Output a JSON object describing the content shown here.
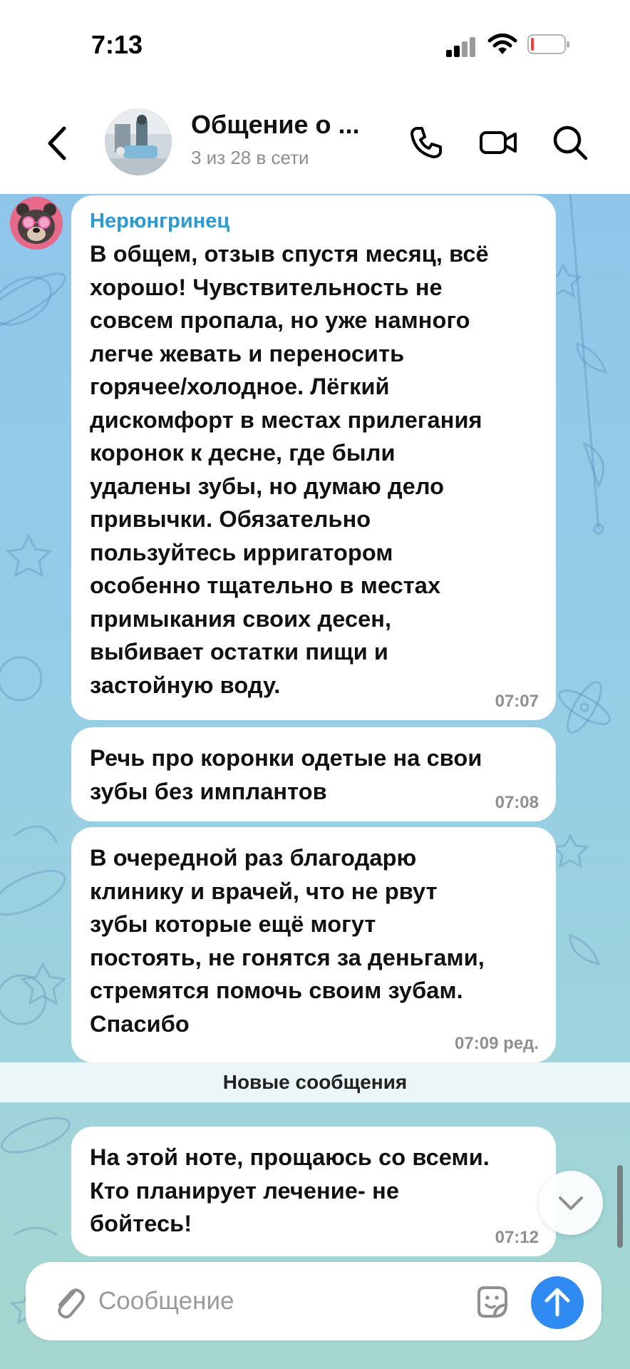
{
  "status_bar": {
    "time": "7:13",
    "battery_level": 0.08
  },
  "header": {
    "title": "Общение о ...",
    "subtitle": "3 из 28 в сети",
    "icons": [
      "chevron-left-icon",
      "phone-icon",
      "video-camera-icon",
      "search-icon"
    ]
  },
  "messages": [
    {
      "sender": "Нерюнгринец",
      "lines": [
        "В общем, отзыв спустя месяц, всё",
        "хорошо! Чувствительность не",
        "совсем пропала, но уже намного",
        "легче жевать и переносить",
        "горячее/холодное. Лёгкий",
        "дискомфорт в местах прилегания",
        "коронок к десне, где были",
        "удалены зубы, но думаю дело",
        "привычки. Обязательно",
        "пользуйтесь ирригатором",
        "особенно тщательно в местах",
        "примыкания своих десен,",
        "выбивает остатки пищи и",
        "застойную воду."
      ],
      "time": "07:07"
    },
    {
      "lines": [
        "Речь про коронки одетые на свои",
        "зубы без имплантов"
      ],
      "time": "07:08"
    },
    {
      "lines": [
        "В очередной раз благодарю",
        "клинику и врачей, что не рвут",
        "зубы которые ещё могут",
        "постоять, не гонятся за деньгами,",
        "стремятся помочь своим зубам.",
        "Спасибо"
      ],
      "time": "07:09 ред."
    },
    {
      "lines": [
        "На этой ноте, прощаюсь со всеми.",
        "Кто планирует лечение- не",
        "бойтесь!"
      ],
      "time": "07:12"
    }
  ],
  "divider": {
    "label": "Новые сообщения"
  },
  "input": {
    "placeholder": "Сообщение",
    "value": ""
  },
  "colors": {
    "accent": "#2f8bf1",
    "sender_name": "#2a9ad3",
    "background_top": "#8fc6ea",
    "background_bottom": "#a6d7cf"
  }
}
